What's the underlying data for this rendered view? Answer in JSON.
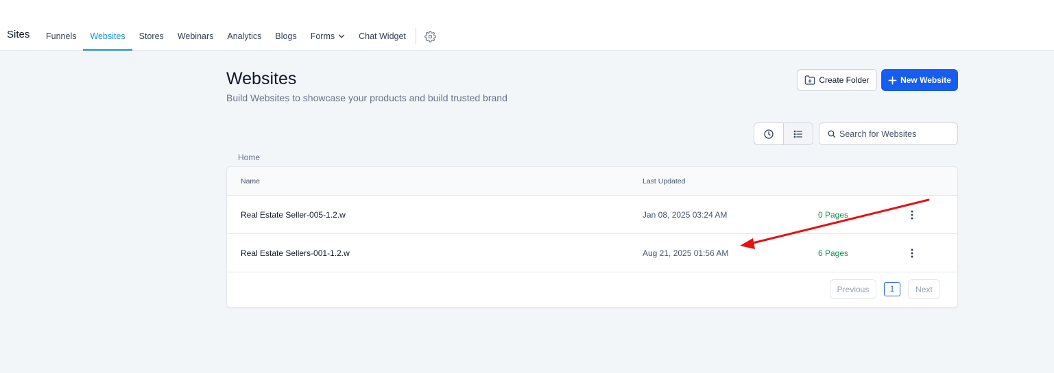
{
  "app": {
    "title": "Sites"
  },
  "nav": {
    "items": [
      {
        "label": "Funnels"
      },
      {
        "label": "Websites",
        "active": true
      },
      {
        "label": "Stores"
      },
      {
        "label": "Webinars"
      },
      {
        "label": "Analytics"
      },
      {
        "label": "Blogs"
      },
      {
        "label": "Forms",
        "has_dropdown": true
      },
      {
        "label": "Chat Widget"
      }
    ],
    "settings_icon": "gear-icon"
  },
  "header": {
    "title": "Websites",
    "subtitle": "Build Websites to showcase your products and build trusted brand",
    "create_folder_label": "Create Folder",
    "new_website_label": "New Website"
  },
  "toolbar": {
    "search_placeholder": "Search for Websites",
    "view_icons": [
      "clock-icon",
      "list-icon"
    ]
  },
  "breadcrumb": {
    "label": "Home"
  },
  "table": {
    "columns": {
      "name": "Name",
      "last_updated": "Last Updated"
    },
    "rows": [
      {
        "name": "Real Estate Seller-005-1.2.w",
        "last_updated": "Jan 08, 2025 03:24 AM",
        "pages": "0 Pages"
      },
      {
        "name": "Real Estate Sellers-001-1.2.w",
        "last_updated": "Aug 21, 2025 01:56 AM",
        "pages": "6 Pages"
      }
    ]
  },
  "pagination": {
    "previous_label": "Previous",
    "current_page": "1",
    "next_label": "Next"
  },
  "colors": {
    "accent": "#155eef",
    "nav_active": "#1d8fd6",
    "pages_green": "#12924b",
    "annotation_arrow": "#e8110f"
  }
}
